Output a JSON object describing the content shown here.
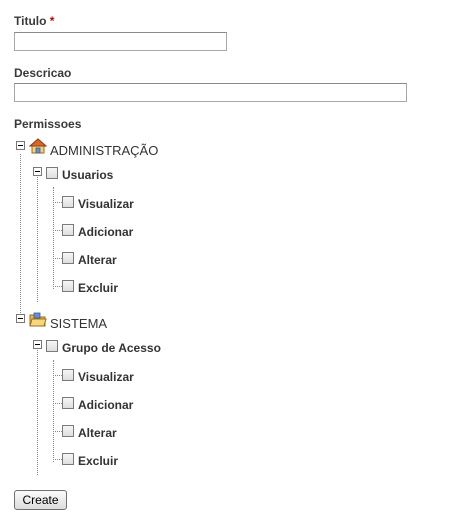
{
  "form": {
    "titulo_label": "Titulo",
    "required_mark": "*",
    "titulo_value": "",
    "descricao_label": "Descricao",
    "descricao_value": "",
    "permissoes_label": "Permissoes",
    "create_button": "Create"
  },
  "tree": {
    "group1": {
      "label": "ADMINISTRAÇÃO",
      "icon": "home-icon",
      "child_label": "Usuarios",
      "leaves": [
        "Visualizar",
        "Adicionar",
        "Alterar",
        "Excluir"
      ]
    },
    "group2": {
      "label": "SISTEMA",
      "icon": "folder-icon",
      "child_label": "Grupo de Acesso",
      "leaves": [
        "Visualizar",
        "Adicionar",
        "Alterar",
        "Excluir"
      ]
    }
  }
}
